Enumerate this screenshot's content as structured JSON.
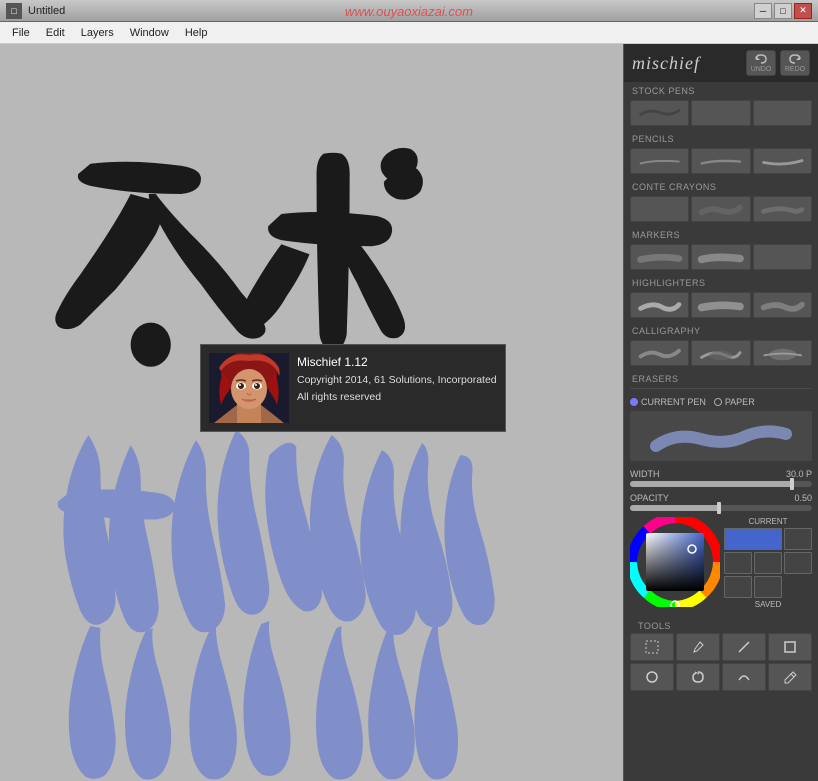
{
  "titlebar": {
    "title": "Untitled",
    "app_icon": "□",
    "watermark": "www.ouyaoxiazai.com"
  },
  "menubar": {
    "items": [
      "File",
      "Edit",
      "Layers",
      "Window",
      "Help"
    ]
  },
  "about_dialog": {
    "title": "Mischief 1.12",
    "line2": "Copyright 2014, 61 Solutions, Incorporated",
    "line3": "All rights reserved"
  },
  "right_panel": {
    "logo": "mischief",
    "undo_label": "UNDO",
    "redo_label": "REDO",
    "sections": {
      "stock_pens": "STOCK PENS",
      "pencils": "PENCILS",
      "conte_crayons": "CONTE CRAYONS",
      "markers": "MARKERS",
      "highlighters": "HIGHLIGHTERS",
      "calligraphy": "CALLIGRAPHY",
      "erasers": "ERASERS"
    },
    "current_pen_label": "CURRENT PEN",
    "paper_label": "PAPER",
    "width_label": "WIDTH",
    "width_value": "30.0 P",
    "opacity_label": "OPACITY",
    "opacity_value": "0.50",
    "color_section": {
      "current_label": "CURRENT",
      "saved_label": "SAVED"
    },
    "tools_label": "TOOLS"
  },
  "canvas": {
    "background": "#b8b8b8"
  }
}
